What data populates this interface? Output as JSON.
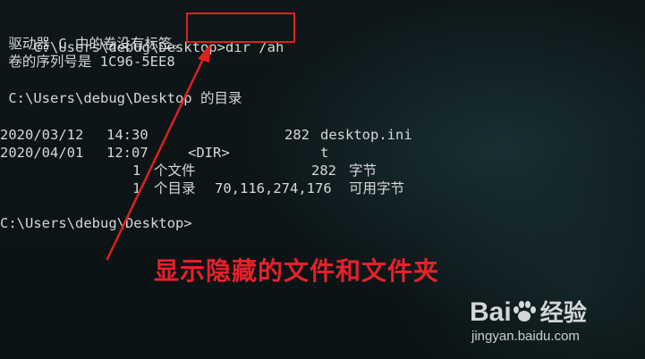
{
  "terminal": {
    "command": {
      "prompt": "C:\\Users\\debug\\Desktop>",
      "input": "dir /ah"
    },
    "volume_line": " 驱动器 C 中的卷没有标签。",
    "serial_line": " 卷的序列号是 1C96-5EE8",
    "dir_line": " C:\\Users\\debug\\Desktop 的目录",
    "entries": [
      {
        "date": "2020/03/12",
        "time": "14:30",
        "type": "",
        "size": "282",
        "name": "desktop.ini"
      },
      {
        "date": "2020/04/01",
        "time": "12:07",
        "type": "<DIR>",
        "size": "",
        "name": "t"
      }
    ],
    "summary": {
      "files_count": "1",
      "files_label": "个文件",
      "files_size": "282",
      "files_unit": "字节",
      "dirs_count": "1",
      "dirs_label": "个目录",
      "free_bytes": "70,116,274,176",
      "free_label": "可用字节"
    },
    "final_prompt": "C:\\Users\\debug\\Desktop>"
  },
  "annotation": {
    "caption": "显示隐藏的文件和文件夹",
    "color": "#e8202a"
  },
  "watermark": {
    "brand": "Bai",
    "brand_suffix": "经验",
    "url": "jingyan.baidu.com",
    "icon": "paw-icon"
  }
}
